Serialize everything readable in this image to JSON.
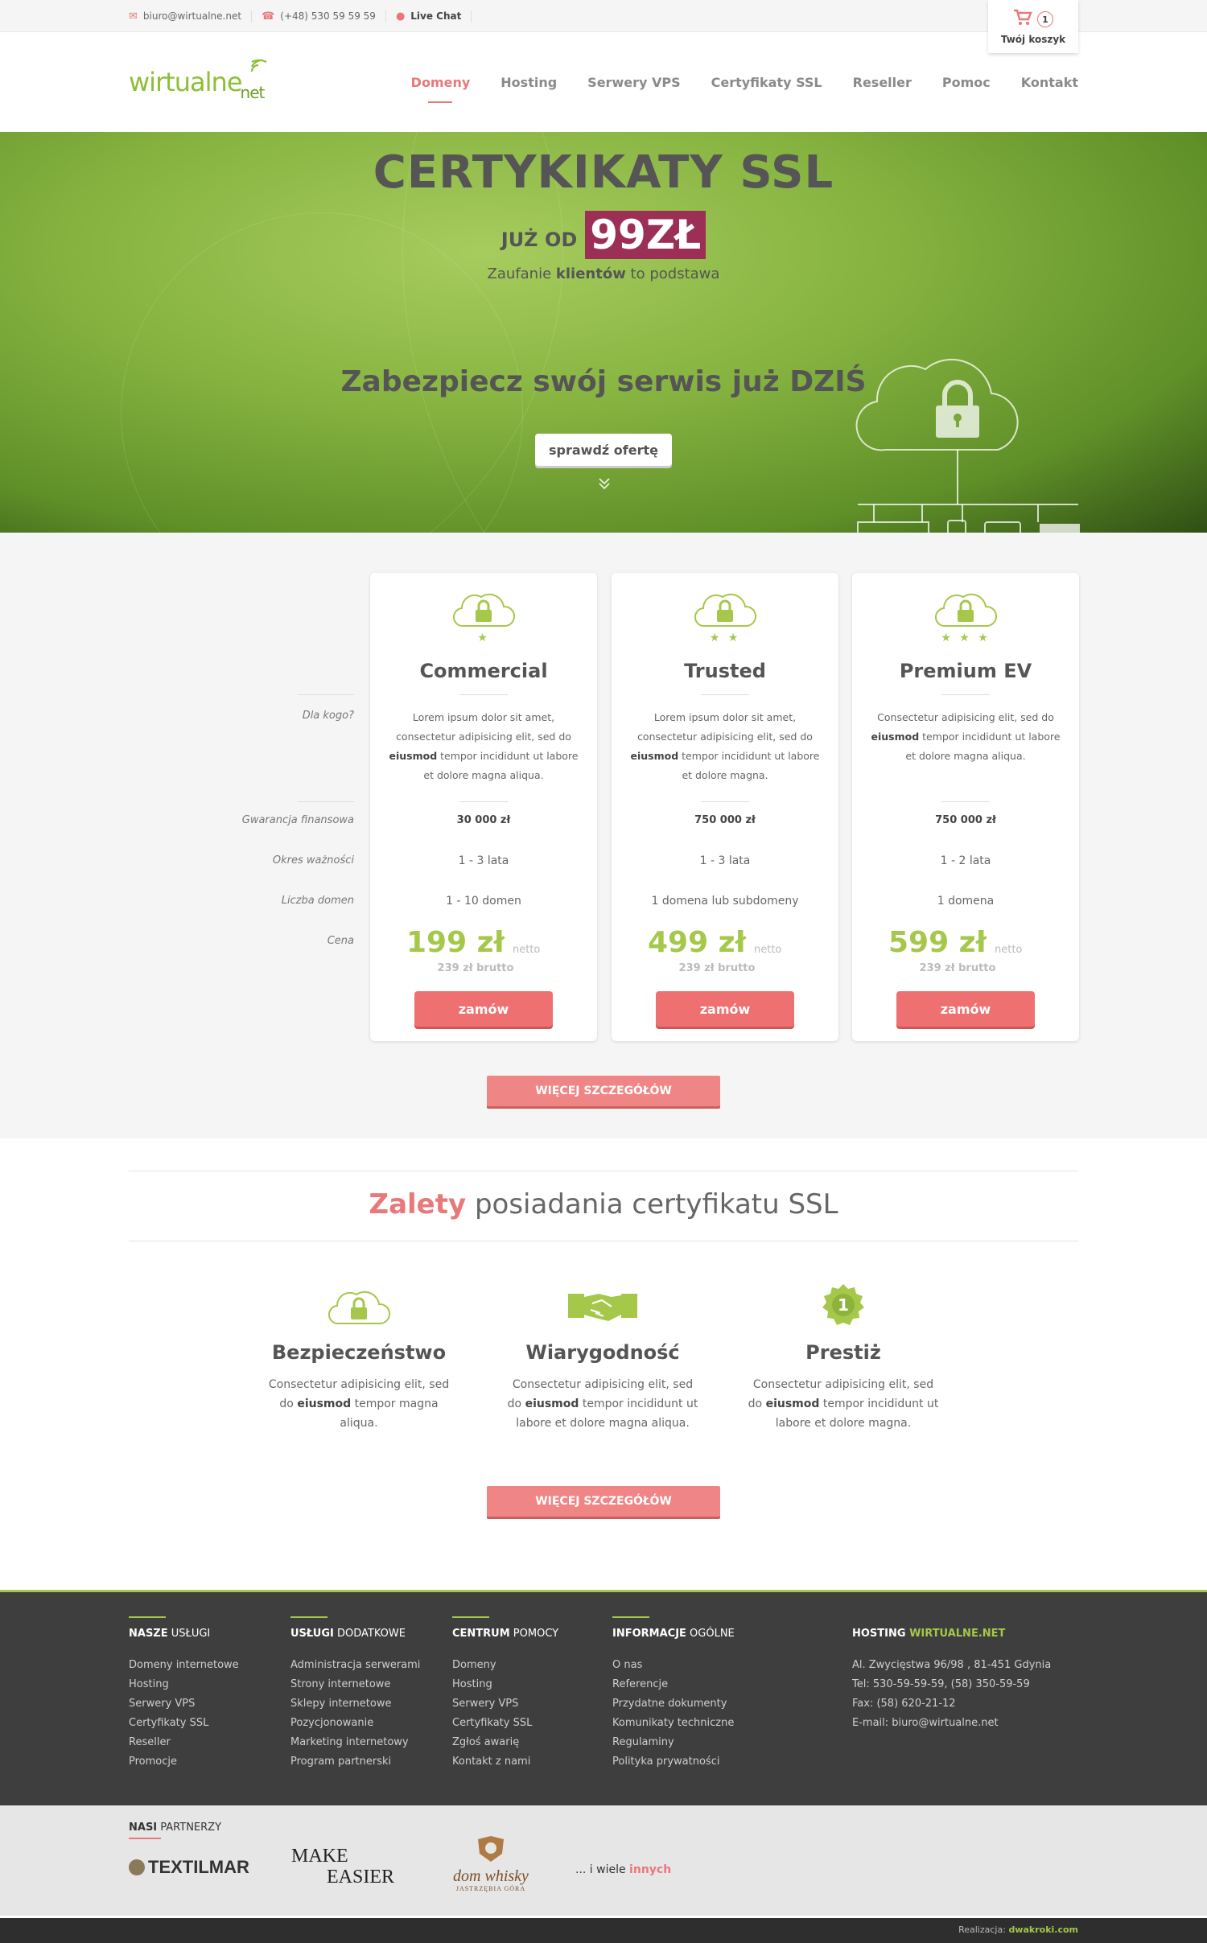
{
  "topbar": {
    "email": "biuro@wirtualne.net",
    "phone": "(+48) 530 59 59 59",
    "livechat": "Live Chat",
    "cart_count": "1",
    "cart_label": "Twój koszyk"
  },
  "logo": {
    "main": "wirtualne",
    "sub": "net"
  },
  "nav": [
    "Domeny",
    "Hosting",
    "Serwery VPS",
    "Certyfikaty SSL",
    "Reseller",
    "Pomoc",
    "Kontakt"
  ],
  "hero": {
    "title": "CERTYKIKATY SSL",
    "price_prefix": "JUŻ OD",
    "price_value": "99ZŁ",
    "tagline_pre": "Zaufanie ",
    "tagline_bold": "klientów",
    "tagline_post": " to podstawa",
    "secure_text": "Zabezpiecz swój serwis już DZIŚ",
    "cta": "sprawdź ofertę"
  },
  "pricing": {
    "row_labels": [
      "Dla kogo?",
      "Gwarancja finansowa",
      "Okres ważności",
      "Liczba domen",
      "Cena"
    ],
    "plans": [
      {
        "stars": "★",
        "name": "Commercial",
        "desc_a": "Lorem ipsum dolor sit amet, consectetur adipisicing elit, sed do ",
        "desc_b": "eiusmod",
        "desc_c": " tempor incididunt ut labore et dolore magna aliqua.",
        "guarantee": "30 000 zł",
        "validity": "1 - 3 lata",
        "domains": "1 - 10 domen",
        "price": "199 zł",
        "netto": "netto",
        "brutto": "239 zł brutto",
        "order": "zamów"
      },
      {
        "stars": "★ ★",
        "name": "Trusted",
        "desc_a": "Lorem ipsum dolor sit amet, consectetur adipisicing elit, sed do ",
        "desc_b": "eiusmod",
        "desc_c": " tempor incididunt ut labore et dolore magna.",
        "guarantee": "750 000 zł",
        "validity": "1 - 3 lata",
        "domains": "1 domena lub subdomeny",
        "price": "499 zł",
        "netto": "netto",
        "brutto": "239 zł brutto",
        "order": "zamów"
      },
      {
        "stars": "★ ★ ★",
        "name": "Premium EV",
        "desc_a": "Consectetur adipisicing elit, sed do ",
        "desc_b": "eiusmod",
        "desc_c": " tempor incididunt ut labore et dolore magna aliqua.",
        "guarantee": "750 000 zł",
        "validity": "1 - 2 lata",
        "domains": "1 domena",
        "price": "599 zł",
        "netto": "netto",
        "brutto": "239 zł brutto",
        "order": "zamów"
      }
    ],
    "more_button": "WIĘCEJ SZCZEGÓŁÓW"
  },
  "advantages": {
    "title_highlight": "Zalety",
    "title_rest": " posiadania certyfikatu SSL",
    "items": [
      {
        "icon": "cloud-lock-icon",
        "title": "Bezpieczeństwo",
        "desc_a": "Consectetur adipisicing elit, sed do ",
        "desc_b": "eiusmod",
        "desc_c": " tempor  magna aliqua."
      },
      {
        "icon": "handshake-icon",
        "title": "Wiarygodność",
        "desc_a": "Consectetur adipisicing elit, sed do ",
        "desc_b": "eiusmod",
        "desc_c": " tempor incididunt ut labore et dolore magna aliqua."
      },
      {
        "icon": "award-badge-icon",
        "title": "Prestiż",
        "desc_a": "Consectetur adipisicing elit, sed do ",
        "desc_b": "eiusmod",
        "desc_c": " tempor incididunt ut labore et dolore magna."
      }
    ],
    "more_button": "WIĘCEJ SZCZEGÓŁÓW"
  },
  "footer": {
    "cols": [
      {
        "h_bold": "NASZE",
        "h_rest": " USŁUGI",
        "links": [
          "Domeny internetowe",
          "Hosting",
          "Serwery VPS",
          "Certyfikaty SSL",
          "Reseller",
          "Promocje"
        ]
      },
      {
        "h_bold": "USŁUGI",
        "h_rest": " DODATKOWE",
        "links": [
          "Administracja serwerami",
          "Strony internetowe",
          "Sklepy internetowe",
          "Pozycjonowanie",
          "Marketing internetowy",
          "Program partnerski"
        ]
      },
      {
        "h_bold": "CENTRUM",
        "h_rest": " POMOCY",
        "links": [
          "Domeny",
          "Hosting",
          "Serwery VPS",
          "Certyfikaty SSL",
          "Zgłoś awarię",
          "Kontakt z nami"
        ]
      },
      {
        "h_bold": "INFORMACJE",
        "h_rest": " OGÓLNE",
        "links": [
          "O nas",
          "Referencje",
          "Przydatne dokumenty",
          "Komunikaty techniczne",
          "Regulaminy",
          "Polityka prywatności"
        ]
      }
    ],
    "contact": {
      "h_bold": "HOSTING",
      "h_green": " WIRTUALNE.NET",
      "lines": [
        "Al. Zwycięstwa 96/98 , 81-451 Gdynia",
        "Tel: 530-59-59-59, (58) 350-59-59",
        "Fax: (58) 620-21-12",
        "E-mail: biuro@wirtualne.net"
      ]
    }
  },
  "partners": {
    "h_bold": "NASI",
    "h_rest": " PARTNERZY",
    "logo1": "TEXTILMAR",
    "logo2_a": "MAKE",
    "logo2_b": "EASIER",
    "logo3_a": "dom whisky",
    "logo3_b": "JASTRZĘBIA GÓRA",
    "more_pre": "... i wiele ",
    "more_link": "innych"
  },
  "bottom": {
    "label": "Realizacja: ",
    "author": "dwakroki.com"
  }
}
